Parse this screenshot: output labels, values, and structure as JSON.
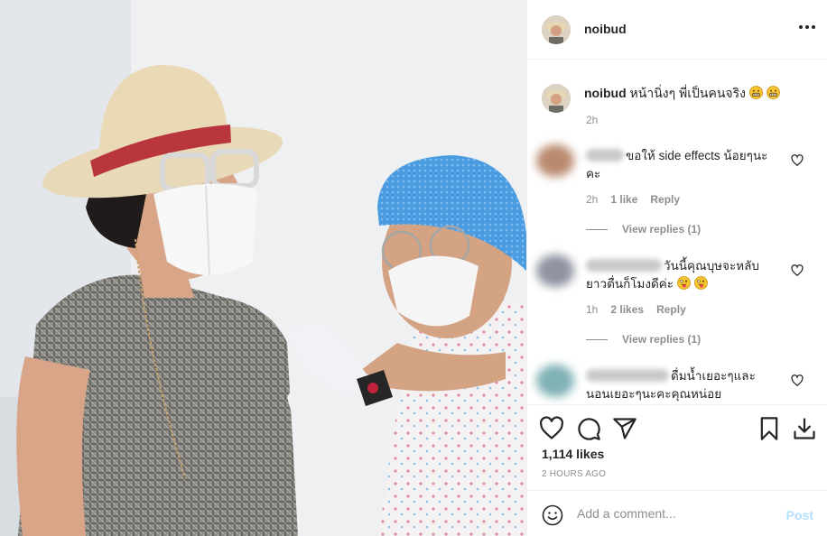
{
  "post": {
    "username": "noibud",
    "caption_text": "หน้านิ่งๆ พี่เป็นคนจริง",
    "caption_time": "2h"
  },
  "comments": [
    {
      "text_line1": "ขอให้ side effects น้อยๆนะ",
      "text_line2": "คะ",
      "time": "2h",
      "likes": "1 like",
      "reply": "Reply",
      "view_replies": "View replies (1)"
    },
    {
      "text_line1": "วันนี้คุณบุษจะหลับ",
      "text_line2": "ยาวตื่นก็โมงดีค่ะ",
      "time": "1h",
      "likes": "2 likes",
      "reply": "Reply",
      "view_replies": "View replies (1)"
    },
    {
      "text_line1": "ดื่มน้ำเยอะๆและ",
      "text_line2": "นอนเยอะๆนะคะคุณหน่อย"
    }
  ],
  "actions": {
    "likes_count": "1,114 likes",
    "time_ago": "2 HOURS AGO",
    "icons": [
      "heart-icon",
      "comment-icon",
      "share-icon",
      "bookmark-icon",
      "download-icon"
    ]
  },
  "add_comment": {
    "placeholder": "Add a comment...",
    "post_label": "Post"
  },
  "colors": {
    "text": "#262626",
    "secondary": "#8e8e8e",
    "border": "#efefef",
    "post_button_disabled": "#b2dffc"
  }
}
